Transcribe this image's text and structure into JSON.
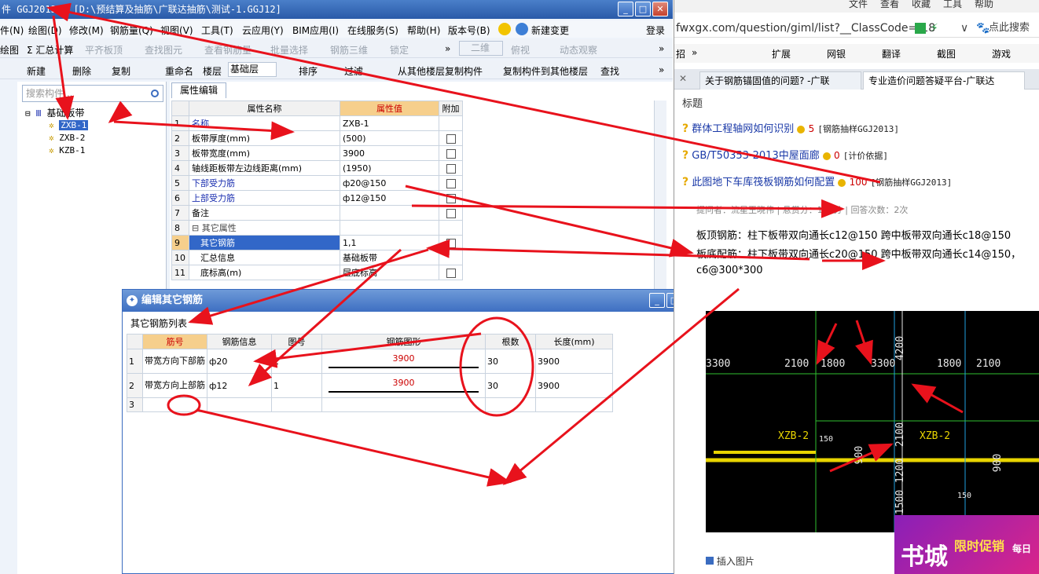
{
  "app": {
    "title": "件 GGJ2013 - [D:\\预结算及抽筋\\广联达抽筋\\测试-1.GGJ12]",
    "window_buttons": [
      "_",
      "□",
      "✕"
    ],
    "menu": [
      "件(N)",
      "绘图(D)",
      "修改(M)",
      "钢筋量(Q)",
      "视图(V)",
      "工具(T)",
      "云应用(Y)",
      "BIM应用(I)",
      "在线服务(S)",
      "帮助(H)",
      "版本号(B)",
      "新建变更",
      "登录"
    ],
    "toolbar1": {
      "items": [
        "绘图",
        "Σ 汇总计算",
        "平齐板顶",
        "查找图元",
        "查看钢筋量",
        "批量选择",
        "钢筋三维",
        "锁定",
        "二维",
        "俯视",
        "动态观察"
      ],
      "more": "»"
    },
    "toolbar2": {
      "items": [
        "新建",
        "删除",
        "复制",
        "重命名",
        "楼层",
        "基础层",
        "排序",
        "过滤",
        "从其他楼层复制构件",
        "复制构件到其他楼层",
        "查找"
      ],
      "more": "»"
    },
    "left_panel": {
      "search_placeholder": "搜索构件...",
      "tree_root": "基础板带",
      "tree_items": [
        "ZXB-1",
        "ZXB-2",
        "KZB-1"
      ]
    },
    "props": {
      "tab": "属性编辑",
      "headers": [
        "属性名称",
        "属性值",
        "附加"
      ],
      "rows": [
        {
          "num": "1",
          "name": "名称",
          "value": "ZXB-1"
        },
        {
          "num": "2",
          "name": "板带厚度(mm)",
          "value": "(500)"
        },
        {
          "num": "3",
          "name": "板带宽度(mm)",
          "value": "3900"
        },
        {
          "num": "4",
          "name": "轴线距板带左边线距离(mm)",
          "value": "(1950)"
        },
        {
          "num": "5",
          "name": "下部受力筋",
          "value": "ф20@150"
        },
        {
          "num": "6",
          "name": "上部受力筋",
          "value": "ф12@150"
        },
        {
          "num": "7",
          "name": "备注",
          "value": ""
        },
        {
          "num": "8",
          "name": "其它属性",
          "value": ""
        },
        {
          "num": "9",
          "name": "其它钢筋",
          "value": "1,1"
        },
        {
          "num": "10",
          "name": "汇总信息",
          "value": "基础板带"
        },
        {
          "num": "11",
          "name": "底标高(m)",
          "value": "层底标高"
        }
      ]
    }
  },
  "dialog": {
    "title": "编辑其它钢筋",
    "subtitle": "其它钢筋列表",
    "headers": [
      "筋号",
      "钢筋信息",
      "图号",
      "钢筋图形",
      "根数",
      "长度(mm)"
    ],
    "rows": [
      {
        "num": "1",
        "name": "带宽方向下部筋",
        "info": "ф20",
        "fig": "1",
        "shape": "3900",
        "count": "30",
        "length": "3900"
      },
      {
        "num": "2",
        "name": "带宽方向上部筋",
        "info": "ф12",
        "fig": "1",
        "shape": "3900",
        "count": "30",
        "length": "3900"
      },
      {
        "num": "3",
        "name": "",
        "info": "",
        "fig": "",
        "shape": "",
        "count": "",
        "length": ""
      }
    ]
  },
  "browser": {
    "menu": [
      "文件",
      "查看",
      "收藏",
      "工具",
      "帮助"
    ],
    "url": "fwxgx.com/question/giml/list?__ClassCode=-18",
    "search_placeholder": "点此搜索",
    "toolbar": [
      "招",
      "»",
      "扩展",
      "网银",
      "翻译",
      "截图",
      "游戏"
    ],
    "tabs": [
      "关于钢筋锚固值的问题? -广联",
      "专业造价问题答疑平台-广联达"
    ],
    "content": {
      "header": "标题",
      "questions": [
        {
          "title": "群体工程轴网如何识别",
          "score": "5",
          "tag": "[钢筋抽样GGJ2013]"
        },
        {
          "title": "GB/T50353-2013中屋面廊",
          "score": "0",
          "tag": "[计价依据]"
        },
        {
          "title": "此图地下车库筏板钢筋如何配置",
          "score": "100",
          "tag": "[钢筋抽样GGJ2013]"
        }
      ],
      "meta": {
        "asker": "提问者：流星王晓伟",
        "reward": "悬赏分：100分",
        "answers": "回答次数：2次",
        "sep": "|"
      },
      "answer_lines": [
        "板顶钢筋：柱下板带双向通长c12@150 跨中板带双向通长c18@150",
        "板底配筋：柱下板带双向通长c20@150 跨中板带双向通长c14@150，",
        "c6@300*300"
      ]
    },
    "cad_labels": [
      "3300",
      "2100",
      "1800",
      "3300",
      "1800",
      "2100",
      "XZB-2",
      "XZB-2",
      "4200",
      "2100",
      "1200",
      "1500",
      "900",
      "900",
      "150",
      "150"
    ],
    "insert_pic": "插入图片",
    "promo": {
      "line1": "书城",
      "line2": "限时促销",
      "line3": "每日"
    }
  }
}
